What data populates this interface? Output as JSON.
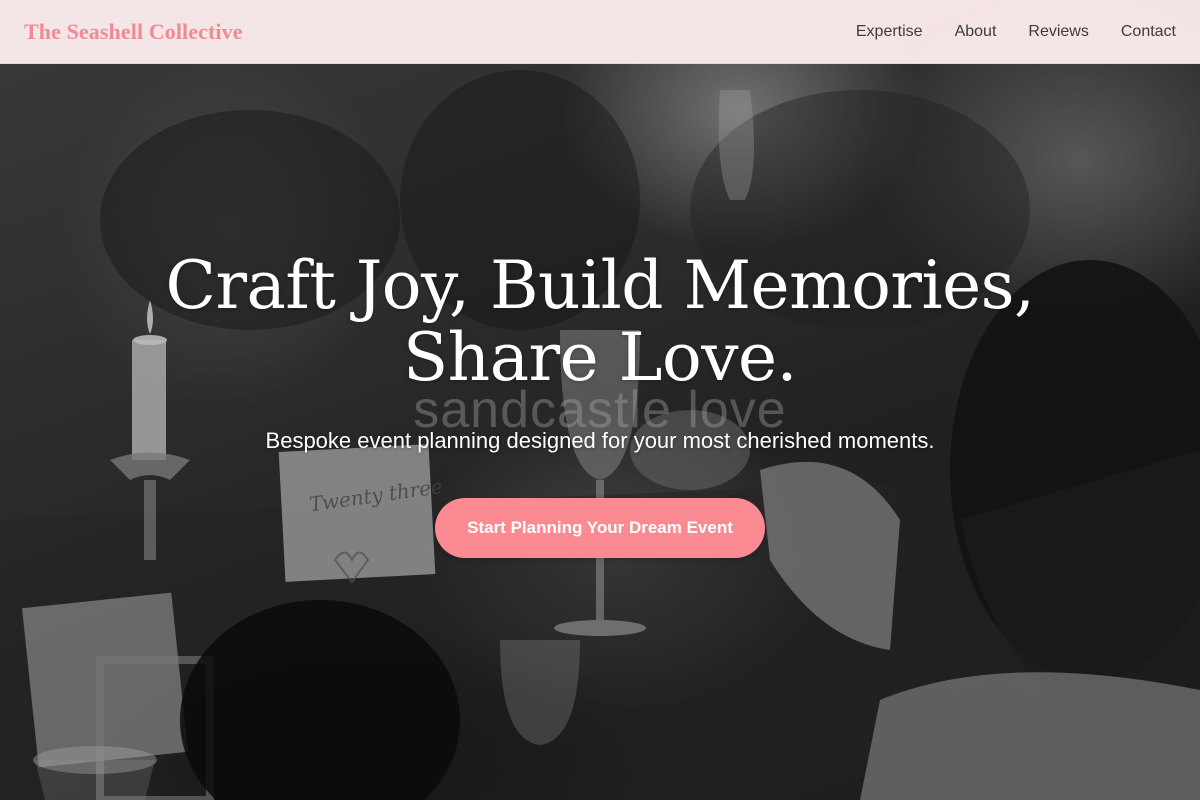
{
  "nav": {
    "brand": "The Seashell Collective",
    "links": [
      {
        "label": "Expertise"
      },
      {
        "label": "About"
      },
      {
        "label": "Reviews"
      },
      {
        "label": "Contact"
      }
    ]
  },
  "hero": {
    "headline_line1": "Craft Joy, Build Memories,",
    "headline_line2": "Share Love.",
    "watermark": "sandcastle love",
    "subtitle": "Bespoke event planning designed for your most cherished moments.",
    "cta_label": "Start Planning Your Dream Event",
    "placard_text": "Twenty three"
  },
  "colors": {
    "brand": "#f08a95",
    "nav_background": "#fcecee",
    "cta_background": "#fb8a93",
    "headline": "#ffffff"
  }
}
